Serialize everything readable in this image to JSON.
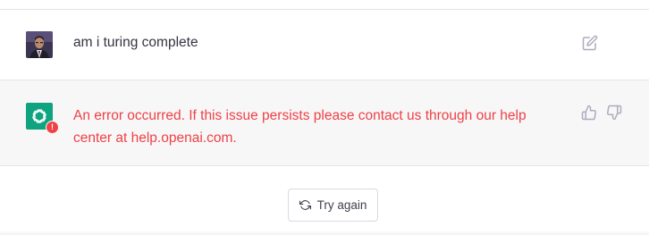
{
  "conversation": {
    "user_message": {
      "text": "am i turing complete",
      "avatar": "user-photo"
    },
    "assistant_message": {
      "error_text": "An error occurred. If this issue persists please contact us through our help center at help.openai.com.",
      "avatar": "openai-logo-icon",
      "status_badge": "!",
      "colors": {
        "avatar_bg": "#10a37f",
        "error": "#ef4146"
      }
    }
  },
  "actions": {
    "edit_icon": "edit-icon",
    "thumbs_up_icon": "thumbs-up-icon",
    "thumbs_down_icon": "thumbs-down-icon",
    "try_again_label": "Try again",
    "try_again_icon": "refresh-icon"
  }
}
